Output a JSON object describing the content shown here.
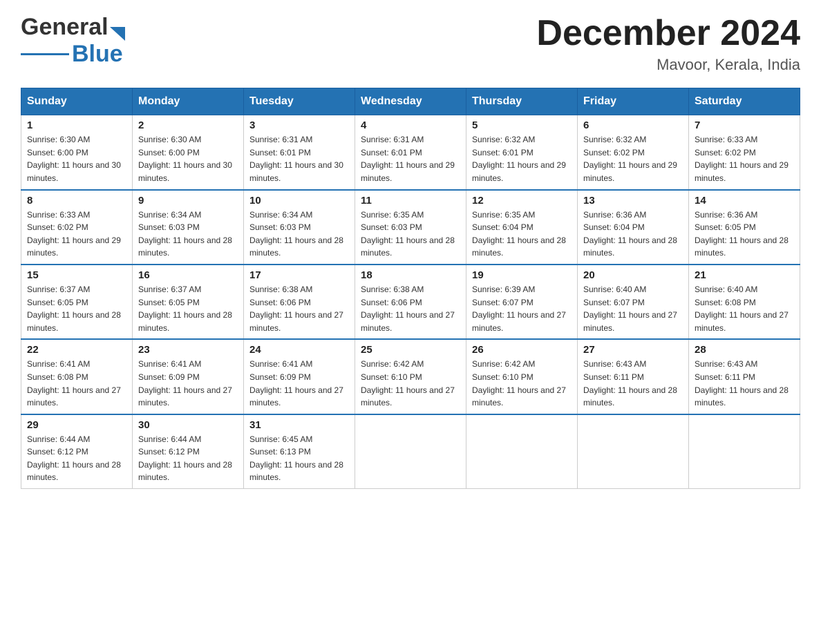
{
  "header": {
    "logo_general": "General",
    "logo_blue": "Blue",
    "month_title": "December 2024",
    "location": "Mavoor, Kerala, India"
  },
  "columns": [
    "Sunday",
    "Monday",
    "Tuesday",
    "Wednesday",
    "Thursday",
    "Friday",
    "Saturday"
  ],
  "weeks": [
    [
      {
        "day": "1",
        "sunrise": "Sunrise: 6:30 AM",
        "sunset": "Sunset: 6:00 PM",
        "daylight": "Daylight: 11 hours and 30 minutes."
      },
      {
        "day": "2",
        "sunrise": "Sunrise: 6:30 AM",
        "sunset": "Sunset: 6:00 PM",
        "daylight": "Daylight: 11 hours and 30 minutes."
      },
      {
        "day": "3",
        "sunrise": "Sunrise: 6:31 AM",
        "sunset": "Sunset: 6:01 PM",
        "daylight": "Daylight: 11 hours and 30 minutes."
      },
      {
        "day": "4",
        "sunrise": "Sunrise: 6:31 AM",
        "sunset": "Sunset: 6:01 PM",
        "daylight": "Daylight: 11 hours and 29 minutes."
      },
      {
        "day": "5",
        "sunrise": "Sunrise: 6:32 AM",
        "sunset": "Sunset: 6:01 PM",
        "daylight": "Daylight: 11 hours and 29 minutes."
      },
      {
        "day": "6",
        "sunrise": "Sunrise: 6:32 AM",
        "sunset": "Sunset: 6:02 PM",
        "daylight": "Daylight: 11 hours and 29 minutes."
      },
      {
        "day": "7",
        "sunrise": "Sunrise: 6:33 AM",
        "sunset": "Sunset: 6:02 PM",
        "daylight": "Daylight: 11 hours and 29 minutes."
      }
    ],
    [
      {
        "day": "8",
        "sunrise": "Sunrise: 6:33 AM",
        "sunset": "Sunset: 6:02 PM",
        "daylight": "Daylight: 11 hours and 29 minutes."
      },
      {
        "day": "9",
        "sunrise": "Sunrise: 6:34 AM",
        "sunset": "Sunset: 6:03 PM",
        "daylight": "Daylight: 11 hours and 28 minutes."
      },
      {
        "day": "10",
        "sunrise": "Sunrise: 6:34 AM",
        "sunset": "Sunset: 6:03 PM",
        "daylight": "Daylight: 11 hours and 28 minutes."
      },
      {
        "day": "11",
        "sunrise": "Sunrise: 6:35 AM",
        "sunset": "Sunset: 6:03 PM",
        "daylight": "Daylight: 11 hours and 28 minutes."
      },
      {
        "day": "12",
        "sunrise": "Sunrise: 6:35 AM",
        "sunset": "Sunset: 6:04 PM",
        "daylight": "Daylight: 11 hours and 28 minutes."
      },
      {
        "day": "13",
        "sunrise": "Sunrise: 6:36 AM",
        "sunset": "Sunset: 6:04 PM",
        "daylight": "Daylight: 11 hours and 28 minutes."
      },
      {
        "day": "14",
        "sunrise": "Sunrise: 6:36 AM",
        "sunset": "Sunset: 6:05 PM",
        "daylight": "Daylight: 11 hours and 28 minutes."
      }
    ],
    [
      {
        "day": "15",
        "sunrise": "Sunrise: 6:37 AM",
        "sunset": "Sunset: 6:05 PM",
        "daylight": "Daylight: 11 hours and 28 minutes."
      },
      {
        "day": "16",
        "sunrise": "Sunrise: 6:37 AM",
        "sunset": "Sunset: 6:05 PM",
        "daylight": "Daylight: 11 hours and 28 minutes."
      },
      {
        "day": "17",
        "sunrise": "Sunrise: 6:38 AM",
        "sunset": "Sunset: 6:06 PM",
        "daylight": "Daylight: 11 hours and 27 minutes."
      },
      {
        "day": "18",
        "sunrise": "Sunrise: 6:38 AM",
        "sunset": "Sunset: 6:06 PM",
        "daylight": "Daylight: 11 hours and 27 minutes."
      },
      {
        "day": "19",
        "sunrise": "Sunrise: 6:39 AM",
        "sunset": "Sunset: 6:07 PM",
        "daylight": "Daylight: 11 hours and 27 minutes."
      },
      {
        "day": "20",
        "sunrise": "Sunrise: 6:40 AM",
        "sunset": "Sunset: 6:07 PM",
        "daylight": "Daylight: 11 hours and 27 minutes."
      },
      {
        "day": "21",
        "sunrise": "Sunrise: 6:40 AM",
        "sunset": "Sunset: 6:08 PM",
        "daylight": "Daylight: 11 hours and 27 minutes."
      }
    ],
    [
      {
        "day": "22",
        "sunrise": "Sunrise: 6:41 AM",
        "sunset": "Sunset: 6:08 PM",
        "daylight": "Daylight: 11 hours and 27 minutes."
      },
      {
        "day": "23",
        "sunrise": "Sunrise: 6:41 AM",
        "sunset": "Sunset: 6:09 PM",
        "daylight": "Daylight: 11 hours and 27 minutes."
      },
      {
        "day": "24",
        "sunrise": "Sunrise: 6:41 AM",
        "sunset": "Sunset: 6:09 PM",
        "daylight": "Daylight: 11 hours and 27 minutes."
      },
      {
        "day": "25",
        "sunrise": "Sunrise: 6:42 AM",
        "sunset": "Sunset: 6:10 PM",
        "daylight": "Daylight: 11 hours and 27 minutes."
      },
      {
        "day": "26",
        "sunrise": "Sunrise: 6:42 AM",
        "sunset": "Sunset: 6:10 PM",
        "daylight": "Daylight: 11 hours and 27 minutes."
      },
      {
        "day": "27",
        "sunrise": "Sunrise: 6:43 AM",
        "sunset": "Sunset: 6:11 PM",
        "daylight": "Daylight: 11 hours and 28 minutes."
      },
      {
        "day": "28",
        "sunrise": "Sunrise: 6:43 AM",
        "sunset": "Sunset: 6:11 PM",
        "daylight": "Daylight: 11 hours and 28 minutes."
      }
    ],
    [
      {
        "day": "29",
        "sunrise": "Sunrise: 6:44 AM",
        "sunset": "Sunset: 6:12 PM",
        "daylight": "Daylight: 11 hours and 28 minutes."
      },
      {
        "day": "30",
        "sunrise": "Sunrise: 6:44 AM",
        "sunset": "Sunset: 6:12 PM",
        "daylight": "Daylight: 11 hours and 28 minutes."
      },
      {
        "day": "31",
        "sunrise": "Sunrise: 6:45 AM",
        "sunset": "Sunset: 6:13 PM",
        "daylight": "Daylight: 11 hours and 28 minutes."
      },
      null,
      null,
      null,
      null
    ]
  ]
}
